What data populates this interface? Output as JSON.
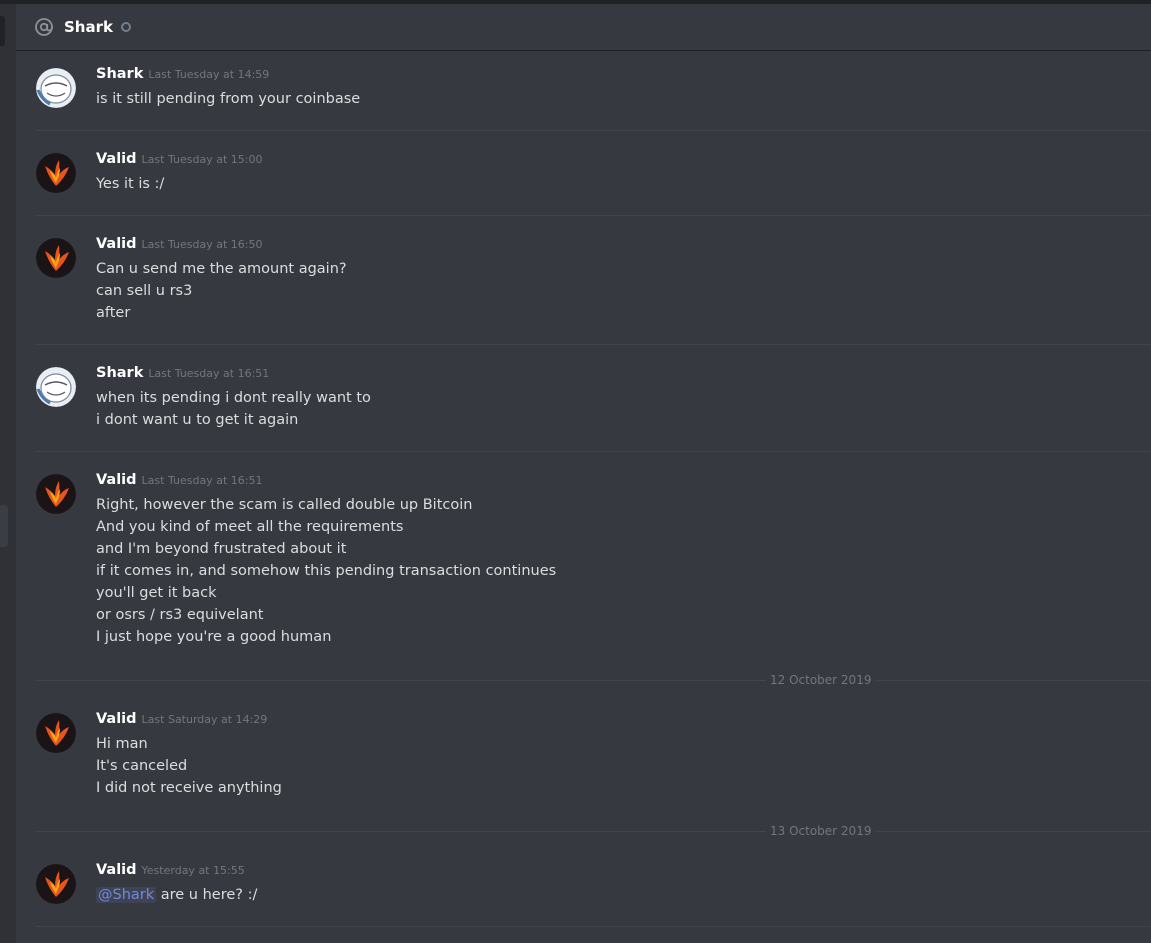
{
  "header": {
    "title": "Shark"
  },
  "colors": {
    "background": "#36393f",
    "mention": "#7289da",
    "username": "#ffffff",
    "text": "#dcddde",
    "timestamp": "#72767d"
  },
  "messages": [
    {
      "author": "Shark",
      "timestamp": "Last Tuesday at 14:59",
      "lines": [
        "is it still pending from your coinbase"
      ]
    },
    {
      "author": "Valid",
      "timestamp": "Last Tuesday at 15:00",
      "lines": [
        "Yes it is :/"
      ]
    },
    {
      "author": "Valid",
      "timestamp": "Last Tuesday at 16:50",
      "lines": [
        "Can u send me the amount again?",
        "can sell u rs3",
        "after"
      ]
    },
    {
      "author": "Shark",
      "timestamp": "Last Tuesday at 16:51",
      "lines": [
        "when its pending i dont really want to",
        "i dont want u to get it again"
      ]
    },
    {
      "author": "Valid",
      "timestamp": "Last Tuesday at 16:51",
      "lines": [
        "Right, however the scam is called double up Bitcoin",
        "And you kind of meet all the requirements",
        "and I'm beyond frustrated about it",
        "if it comes in, and somehow this pending transaction continues",
        "you'll get it back",
        "or osrs / rs3 equivelant",
        "I just hope you're a good human"
      ]
    },
    {
      "author": "Valid",
      "timestamp": "Last Saturday at 14:29",
      "lines": [
        "Hi man",
        "It's canceled",
        "I did not receive anything"
      ]
    },
    {
      "author": "Valid",
      "timestamp": "Yesterday at 15:55",
      "mention": "@Shark",
      "lines": [
        "are u here? :/"
      ]
    }
  ],
  "date_separators": [
    "12 October 2019",
    "13 October 2019"
  ]
}
